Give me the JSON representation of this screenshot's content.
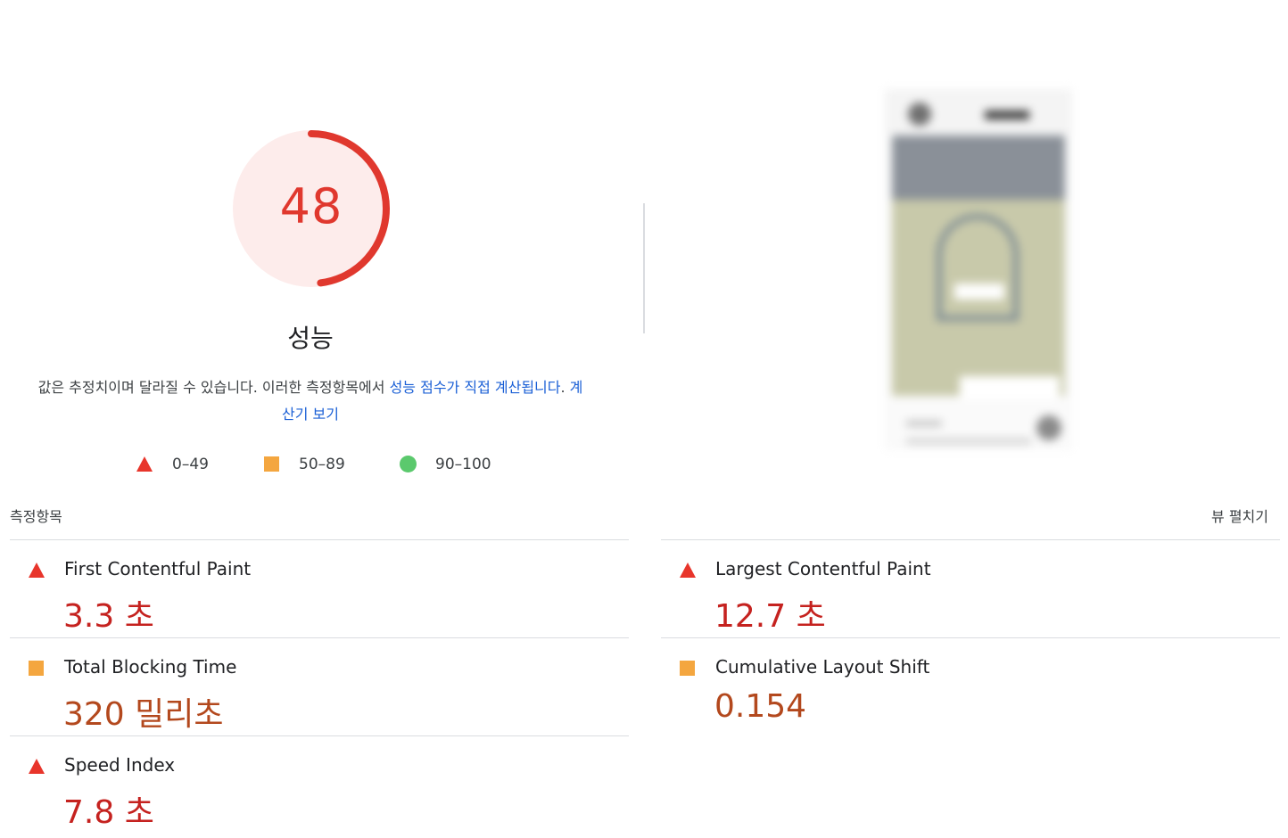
{
  "score": {
    "value": "48",
    "fraction": 0.48,
    "label": "성능",
    "color": "#e0382e",
    "track_fill": "#fdeceb"
  },
  "description": {
    "text": "값은 추정치이며 달라질 수 있습니다. 이러한 측정항목에서 ",
    "link1": "성능 점수가 직접 계산됩니다",
    "link2": "계산기 보기"
  },
  "legend": [
    {
      "shape": "triangle",
      "color": "#e8352b",
      "range": "0–49"
    },
    {
      "shape": "square",
      "color": "#f4a63f",
      "range": "50–89"
    },
    {
      "shape": "circle",
      "color": "#5bc96d",
      "range": "90–100"
    }
  ],
  "metrics_header": {
    "title": "측정항목",
    "expand_label": "뷰 펼치기"
  },
  "metrics": {
    "left": [
      {
        "name": "First Contentful Paint",
        "value": "3.3 초",
        "rating": "fail"
      },
      {
        "name": "Total Blocking Time",
        "value": "320 밀리초",
        "rating": "average"
      },
      {
        "name": "Speed Index",
        "value": "7.8 초",
        "rating": "fail"
      }
    ],
    "right": [
      {
        "name": "Largest Contentful Paint",
        "value": "12.7 초",
        "rating": "fail"
      },
      {
        "name": "Cumulative Layout Shift",
        "value": "0.154",
        "rating": "average"
      }
    ]
  }
}
